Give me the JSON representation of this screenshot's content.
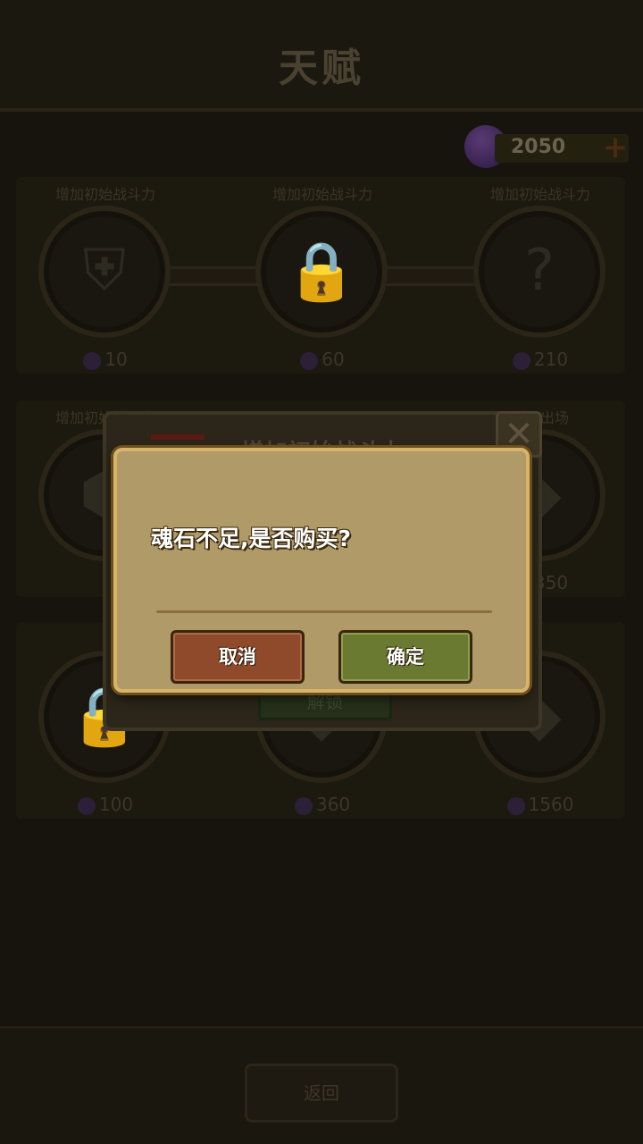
{
  "header": {
    "title": "天赋"
  },
  "currency": {
    "icon": "soulstone-icon",
    "value": "2050",
    "add_label": "+"
  },
  "talent_rows": [
    {
      "items": [
        {
          "name": "增加初始战斗力",
          "icon": "armor-icon",
          "glyph": "⛨",
          "cost": "10"
        },
        {
          "name": "增加初始战斗力",
          "icon": "lock-icon",
          "glyph": "🔒",
          "cost": "60"
        },
        {
          "name": "增加初始战斗力",
          "icon": "question-icon",
          "glyph": "?",
          "cost": "210"
        }
      ]
    },
    {
      "items": [
        {
          "name": "增加初始战斗力",
          "icon": "hexagon-icon",
          "glyph": "⬢",
          "cost": ""
        },
        {
          "name": "",
          "icon": "hidden-icon",
          "glyph": "",
          "cost": ""
        },
        {
          "name": "增加出场",
          "icon": "gem-icon",
          "glyph": "◆",
          "cost": "350"
        }
      ]
    },
    {
      "items": [
        {
          "name": "",
          "icon": "lock-icon",
          "glyph": "🔒",
          "cost": "100"
        },
        {
          "name": "",
          "icon": "gem-icon",
          "glyph": "◆",
          "cost": "360"
        },
        {
          "name": "",
          "icon": "gem-icon",
          "glyph": "◆",
          "cost": "1560"
        }
      ]
    }
  ],
  "detail_panel": {
    "title": "增加初始战斗力",
    "close_label": "✕",
    "unlock_label": "解锁"
  },
  "dialog": {
    "message": "魂石不足,是否购买?",
    "cancel_label": "取消",
    "confirm_label": "确定"
  },
  "footer": {
    "back_label": "返回"
  }
}
